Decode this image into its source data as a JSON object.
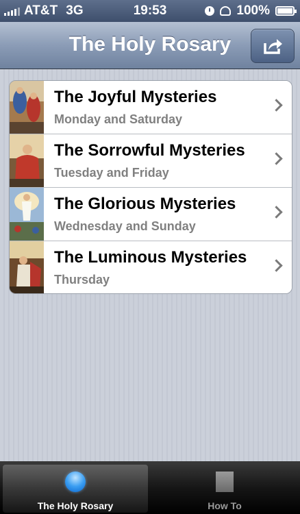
{
  "status_bar": {
    "carrier": "AT&T",
    "network": "3G",
    "time": "19:53",
    "battery": "100%"
  },
  "nav": {
    "title": "The Holy Rosary",
    "share_icon": "share-icon"
  },
  "mysteries": [
    {
      "title": "The Joyful Mysteries",
      "subtitle": "Monday and Saturday"
    },
    {
      "title": "The Sorrowful Mysteries",
      "subtitle": "Tuesday and Friday"
    },
    {
      "title": "The Glorious Mysteries",
      "subtitle": "Wednesday and Sunday"
    },
    {
      "title": "The Luminous Mysteries",
      "subtitle": "Thursday"
    }
  ],
  "tabs": [
    {
      "label": "The Holy Rosary",
      "icon": "circle-icon",
      "active": true
    },
    {
      "label": "How To",
      "icon": "square-icon",
      "active": false
    }
  ],
  "colors": {
    "nav_accent": "#7d8fab",
    "tab_active_icon": "#3b9ef2"
  }
}
